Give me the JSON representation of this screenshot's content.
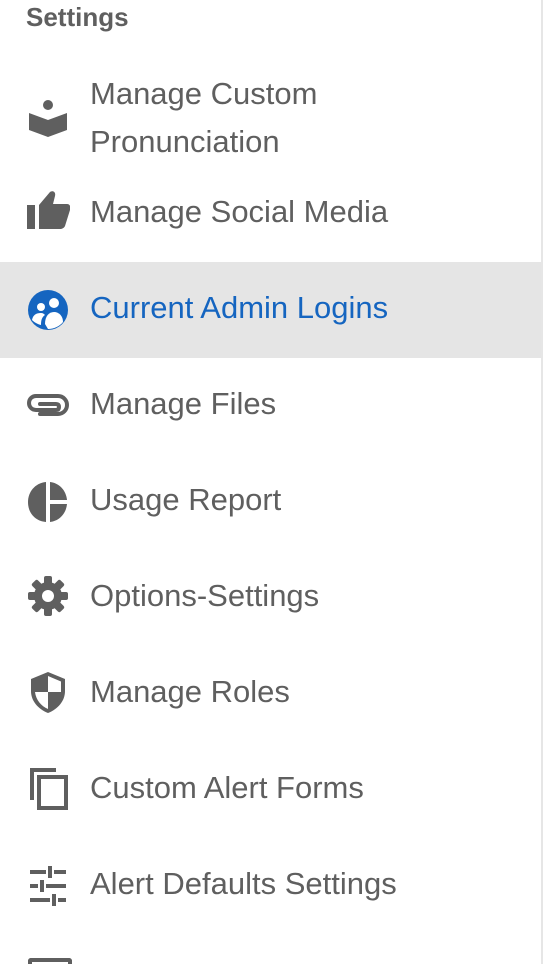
{
  "settings": {
    "title": "Settings",
    "items": [
      {
        "label": "Manage Custom Pronunciation",
        "icon": "reading-person-icon"
      },
      {
        "label": "Manage Social Media",
        "icon": "thumbs-up-icon"
      },
      {
        "label": "Current Admin Logins",
        "icon": "people-circle-icon",
        "active": true
      },
      {
        "label": "Manage Files",
        "icon": "paperclip-icon"
      },
      {
        "label": "Usage Report",
        "icon": "pie-chart-icon"
      },
      {
        "label": "Options-Settings",
        "icon": "gear-icon"
      },
      {
        "label": "Manage Roles",
        "icon": "shield-icon"
      },
      {
        "label": "Custom Alert Forms",
        "icon": "copy-icon"
      },
      {
        "label": "Alert Defaults Settings",
        "icon": "sliders-icon"
      }
    ]
  },
  "colors": {
    "text": "#5f5f5f",
    "active_text": "#1565c0",
    "active_bg": "#e5e5e5"
  }
}
